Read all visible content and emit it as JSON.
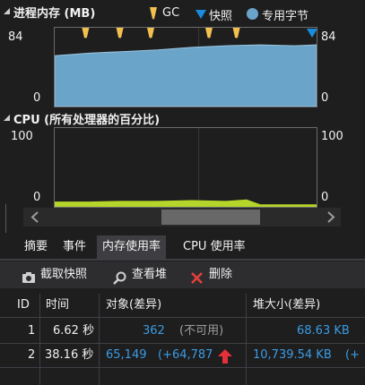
{
  "memory_section": {
    "title": "进程内存 (MB)",
    "legend": {
      "gc_label": "GC",
      "snapshot_label": "快照",
      "private_bytes_label": "专用字节",
      "gc_color": "#f2c04f",
      "snapshot_color": "#1a8cde",
      "private_bytes_color": "#6aa4c9"
    },
    "y_max_left": "84",
    "y_min_left": "0",
    "y_max_right": "84",
    "y_min_right": "0"
  },
  "cpu_section": {
    "title": "CPU (所有处理器的百分比)",
    "y_max_left": "100",
    "y_min_left": "0",
    "y_max_right": "100",
    "y_min_right": "0",
    "series_color": "#b5d52a"
  },
  "chart_data": [
    {
      "type": "area",
      "series": [
        {
          "name": "专用字节",
          "x": [
            0,
            5,
            10,
            15,
            20,
            25,
            30,
            35,
            38.16
          ],
          "values": [
            59,
            62,
            64,
            66,
            69,
            71,
            72,
            71,
            72
          ]
        }
      ],
      "markers": {
        "GC": [
          4.5,
          9.5,
          14,
          22.5,
          26.5
        ],
        "快照": [
          38.2
        ]
      },
      "ylim": [
        0,
        84
      ]
    },
    {
      "type": "area",
      "series": [
        {
          "x": [
            0,
            5,
            10,
            15,
            20,
            25,
            28,
            30,
            38.16
          ],
          "values": [
            5,
            5,
            6,
            6,
            7,
            6,
            8,
            1,
            1
          ]
        }
      ],
      "ylim": [
        0,
        100
      ]
    }
  ],
  "tabs": [
    {
      "label": "摘要"
    },
    {
      "label": "事件"
    },
    {
      "label": "内存使用率"
    },
    {
      "label": "CPU 使用率"
    }
  ],
  "toolbar": {
    "snapshot_label": "截取快照",
    "view_heap_label": "查看堆",
    "delete_label": "删除"
  },
  "table": {
    "headers": [
      "ID",
      "时间",
      "对象(差异)",
      "堆大小(差异)"
    ],
    "rows": [
      {
        "id": "1",
        "time": "6.62 秒",
        "objects": "362",
        "objects_diff": "(不可用)",
        "heap": "68.63 KB",
        "heap_diff": ""
      },
      {
        "id": "2",
        "time": "38.16 秒",
        "objects": "65,149",
        "objects_diff": "(+64,787",
        "heap": "10,739.54 KB",
        "heap_diff": "(+"
      }
    ]
  }
}
